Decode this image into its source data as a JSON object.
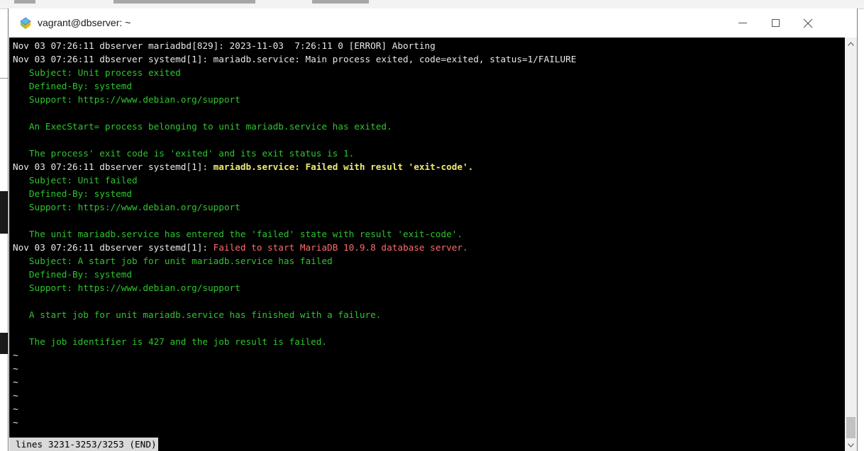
{
  "window": {
    "title": "vagrant@dbserver: ~",
    "icon": "putty-icon"
  },
  "terminal": {
    "lines": [
      [
        {
          "t": "Nov 03 07:26:11 dbserver mariadbd[829]: 2023-11-03  7:26:11 0 [ERROR] Aborting",
          "c": "w"
        }
      ],
      [
        {
          "t": "Nov 03 07:26:11 dbserver systemd[1]: mariadb.service: Main process exited, code=exited, status=1/FAILURE",
          "c": "w"
        }
      ],
      [
        {
          "t": "   Subject: Unit process exited",
          "c": "g"
        }
      ],
      [
        {
          "t": "   Defined-By: systemd",
          "c": "g"
        }
      ],
      [
        {
          "t": "   Support: https://www.debian.org/support",
          "c": "g"
        }
      ],
      [
        {
          "t": "",
          "c": "g"
        }
      ],
      [
        {
          "t": "   An ExecStart= process belonging to unit mariadb.service has exited.",
          "c": "g"
        }
      ],
      [
        {
          "t": "",
          "c": "g"
        }
      ],
      [
        {
          "t": "   The process' exit code is 'exited' and its exit status is 1.",
          "c": "g"
        }
      ],
      [
        {
          "t": "Nov 03 07:26:11 dbserver systemd[1]: ",
          "c": "w"
        },
        {
          "t": "mariadb.service: Failed with result 'exit-code'.",
          "c": "y"
        }
      ],
      [
        {
          "t": "   Subject: Unit failed",
          "c": "g"
        }
      ],
      [
        {
          "t": "   Defined-By: systemd",
          "c": "g"
        }
      ],
      [
        {
          "t": "   Support: https://www.debian.org/support",
          "c": "g"
        }
      ],
      [
        {
          "t": "",
          "c": "g"
        }
      ],
      [
        {
          "t": "   The unit mariadb.service has entered the 'failed' state with result 'exit-code'.",
          "c": "g"
        }
      ],
      [
        {
          "t": "Nov 03 07:26:11 dbserver systemd[1]: ",
          "c": "w"
        },
        {
          "t": "Failed to start MariaDB 10.9.8 database server.",
          "c": "r"
        }
      ],
      [
        {
          "t": "   Subject: A start job for unit mariadb.service has failed",
          "c": "g"
        }
      ],
      [
        {
          "t": "   Defined-By: systemd",
          "c": "g"
        }
      ],
      [
        {
          "t": "   Support: https://www.debian.org/support",
          "c": "g"
        }
      ],
      [
        {
          "t": "",
          "c": "g"
        }
      ],
      [
        {
          "t": "   A start job for unit mariadb.service has finished with a failure.",
          "c": "g"
        }
      ],
      [
        {
          "t": "",
          "c": "g"
        }
      ],
      [
        {
          "t": "   The job identifier is 427 and the job result is failed.",
          "c": "g"
        }
      ],
      [
        {
          "t": "~",
          "c": "t"
        }
      ],
      [
        {
          "t": "~",
          "c": "t"
        }
      ],
      [
        {
          "t": "~",
          "c": "t"
        }
      ],
      [
        {
          "t": "~",
          "c": "t"
        }
      ],
      [
        {
          "t": "~",
          "c": "t"
        }
      ],
      [
        {
          "t": "~",
          "c": "t"
        }
      ]
    ],
    "status": "lines 3231-3253/3253 (END)"
  },
  "colors": {
    "default_text": "#e8e8e8",
    "info_text": "#2ec52e",
    "highlight_text": "#f0eb72",
    "error_text": "#ff6b6b",
    "terminal_bg": "#000000"
  }
}
